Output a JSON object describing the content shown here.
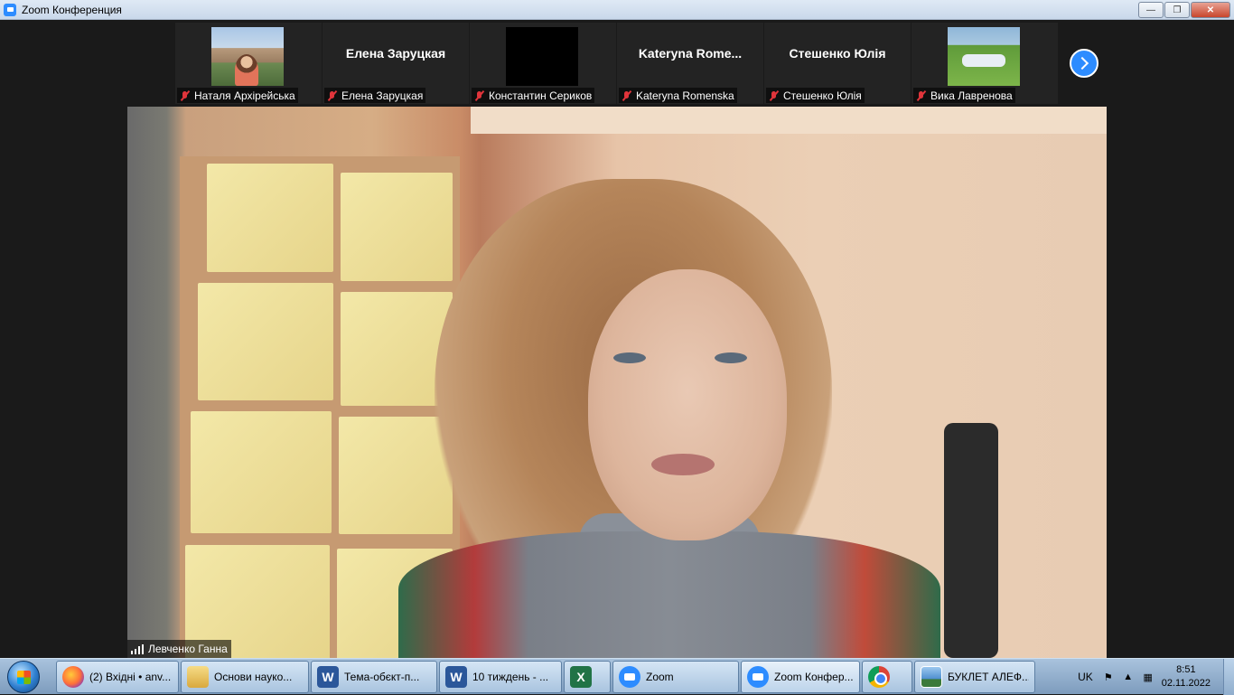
{
  "window": {
    "title": "Zoom Конференция",
    "controls": [
      "minimize",
      "maximize",
      "close"
    ]
  },
  "gallery": {
    "participants": [
      {
        "display_name": "",
        "label": "Наталя Архірейська",
        "muted": true,
        "video": "photo-palace"
      },
      {
        "display_name": "Елена Заруцкая",
        "label": "Елена Заруцкая",
        "muted": true,
        "video": "none"
      },
      {
        "display_name": "",
        "label": "Константин Сериков",
        "muted": true,
        "video": "black"
      },
      {
        "display_name": "Kateryna  Rome...",
        "label": "Kateryna Romenska",
        "muted": true,
        "video": "none"
      },
      {
        "display_name": "Стешенко Юлія",
        "label": "Стешенко Юлія",
        "muted": true,
        "video": "none"
      },
      {
        "display_name": "",
        "label": "Вика Лавренова",
        "muted": true,
        "video": "photo-grass"
      }
    ],
    "next_icon": "chevron-right-icon"
  },
  "active_speaker": {
    "name": "Левченко Ганна",
    "icon": "signal-bars-icon"
  },
  "taskbar": {
    "start_icon": "windows-start-orb",
    "items": [
      {
        "icon": "firefox-icon",
        "label": "(2) Вхідні • anv..."
      },
      {
        "icon": "folder-icon",
        "label": "Основи науко..."
      },
      {
        "icon": "word-icon",
        "label": "Тема-обєкт-п..."
      },
      {
        "icon": "word-icon",
        "label": "10 тиждень - ..."
      },
      {
        "icon": "excel-icon",
        "label": ""
      },
      {
        "icon": "zoom-icon",
        "label": "Zoom"
      },
      {
        "icon": "zoom-icon",
        "label": "Zoom Конфер..."
      },
      {
        "icon": "chrome-icon",
        "label": ""
      },
      {
        "icon": "image-viewer-icon",
        "label": "БУКЛЕТ АЛЕФ..."
      }
    ],
    "tray": {
      "language": "UK",
      "time": "8:51",
      "date": "02.11.2022"
    }
  },
  "colors": {
    "zoom_blue": "#2d8cff",
    "muted_red": "#e0343b",
    "background": "#1a1a1a"
  }
}
